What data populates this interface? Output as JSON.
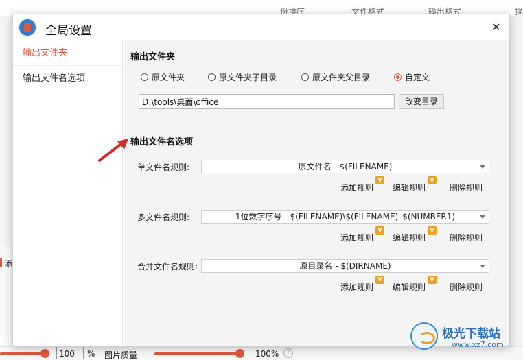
{
  "background": {
    "top_tabs": [
      "份排序",
      "文件格式",
      "输出格式",
      "操"
    ],
    "left_add": "添",
    "bottom": {
      "value1": "100",
      "unit1": "%",
      "quality_label": "图片质量",
      "value2": "100%",
      "help": "?"
    }
  },
  "dialog": {
    "title": "全局设置",
    "close": "✕",
    "sidebar": {
      "items": [
        {
          "label": "输出文件夹",
          "active": true
        },
        {
          "label": "输出文件名选项",
          "active": false
        }
      ]
    },
    "output_folder": {
      "section_title": "输出文件夹",
      "options": [
        {
          "label": "原文件夹",
          "checked": false
        },
        {
          "label": "原文件夹子目录",
          "checked": false
        },
        {
          "label": "原文件夹父目录",
          "checked": false
        },
        {
          "label": "自定义",
          "checked": true
        }
      ],
      "path_value": "D:\\tools\\桌面\\office",
      "change_button": "改变目录"
    },
    "filename_options": {
      "section_title": "输出文件名选项",
      "rules": [
        {
          "label": "单文件名规则:",
          "value": "原文件名 - $(FILENAME)"
        },
        {
          "label": "多文件名规则:",
          "value": "1位数字序号 - $(FILENAME)\\$(FILENAME)_$(NUMBER1)"
        },
        {
          "label": "合并文件名规则:",
          "value": "原目录名 - $(DIRNAME)"
        }
      ],
      "actions": {
        "add": "添加规则",
        "edit": "编辑规则",
        "delete": "删除规则",
        "badge": "V"
      }
    }
  },
  "watermark": {
    "line1": "极光下载站",
    "line2": "www.xz7.com"
  },
  "colors": {
    "accent": "#e0573f",
    "badge": "#f0a020",
    "brand_blue": "#2a6fc0"
  }
}
